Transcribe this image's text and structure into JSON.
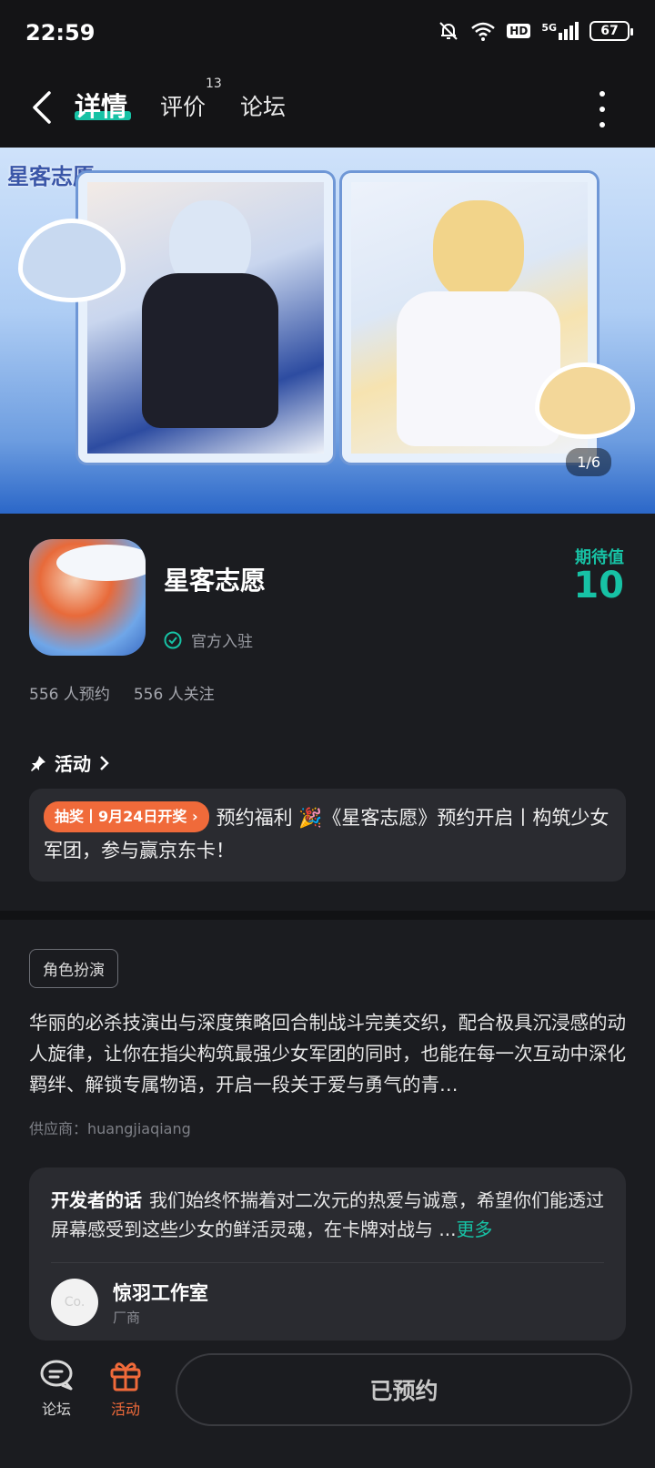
{
  "status_bar": {
    "time": "22:59",
    "battery": "67",
    "network": "5G",
    "hd_label": "HD",
    "icons": [
      "bell-off-icon",
      "wifi-icon",
      "hd-icon",
      "signal-icon",
      "battery-icon"
    ]
  },
  "nav": {
    "tabs": [
      {
        "label": "详情",
        "active": true
      },
      {
        "label": "评价",
        "badge": "13"
      },
      {
        "label": "论坛"
      }
    ],
    "accent": "#17c2a5"
  },
  "banner": {
    "logo_text": "星客志愿",
    "counter": "1/6"
  },
  "app": {
    "name": "星客志愿",
    "official_label": "官方入驻",
    "expect_label": "期待值",
    "expect_value": "10",
    "reservations": "556 人预约",
    "followers": "556 人关注"
  },
  "activity": {
    "header": "活动",
    "tag": "抽奖丨9月24日开奖",
    "text": "预约福利 🎉《星客志愿》预约开启丨构筑少女军团，参与赢京东卡！",
    "tag_color": "#f06a3a"
  },
  "details": {
    "genre": "角色扮演",
    "description": "华丽的必杀技演出与深度策略回合制战斗完美交织，配合极具沉浸感的动人旋律，让你在指尖构筑最强少女军团的同时，也能在每一次互动中深化羁绊、解锁专属物语，开启一段关于爱与勇气的青…",
    "supplier": "供应商：huangjiaqiang"
  },
  "developer": {
    "title": "开发者的话",
    "text": "我们始终怀揣着对二次元的热爱与诚意，希望你们能透过屏幕感受到这些少女的鲜活灵魂，在卡牌对战与 ...",
    "more": "更多",
    "avatar_text": "Co.",
    "studio": "惊羽工作室",
    "role": "厂商"
  },
  "bottom_bar": {
    "forum_label": "论坛",
    "activity_label": "活动",
    "reserve_label": "已预约"
  }
}
